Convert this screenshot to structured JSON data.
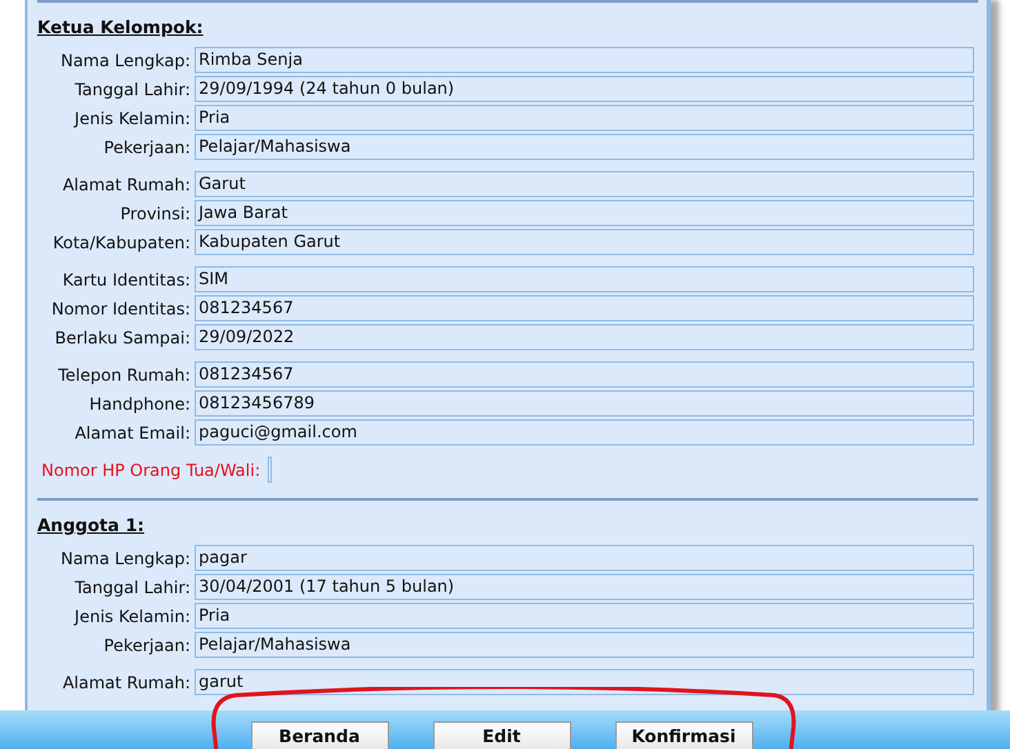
{
  "sections": [
    {
      "title": "Ketua Kelompok:",
      "groups": [
        [
          {
            "label": "Nama Lengkap:",
            "value": "Rimba Senja",
            "missing": false
          },
          {
            "label": "Tanggal Lahir:",
            "value": "29/09/1994 (24 tahun 0 bulan)",
            "missing": false
          },
          {
            "label": "Jenis Kelamin:",
            "value": "Pria",
            "missing": false
          },
          {
            "label": "Pekerjaan:",
            "value": "Pelajar/Mahasiswa",
            "missing": false
          }
        ],
        [
          {
            "label": "Alamat Rumah:",
            "value": "Garut",
            "missing": false
          },
          {
            "label": "Provinsi:",
            "value": "Jawa Barat",
            "missing": false
          },
          {
            "label": "Kota/Kabupaten:",
            "value": "Kabupaten Garut",
            "missing": false
          }
        ],
        [
          {
            "label": "Kartu Identitas:",
            "value": "SIM",
            "missing": false
          },
          {
            "label": "Nomor Identitas:",
            "value": "081234567",
            "missing": false
          },
          {
            "label": "Berlaku Sampai:",
            "value": "29/09/2022",
            "missing": false
          }
        ],
        [
          {
            "label": "Telepon Rumah:",
            "value": "081234567",
            "missing": false
          },
          {
            "label": "Handphone:",
            "value": "08123456789",
            "missing": false
          },
          {
            "label": "Alamat Email:",
            "value": "paguci@gmail.com",
            "missing": false
          }
        ],
        [
          {
            "label": "Nomor HP Orang Tua/Wali:",
            "missing": true
          }
        ]
      ]
    },
    {
      "title": "Anggota 1:",
      "groups": [
        [
          {
            "label": "Nama Lengkap:",
            "value": "pagar",
            "missing": false
          },
          {
            "label": "Tanggal Lahir:",
            "value": "30/04/2001 (17 tahun 5 bulan)",
            "missing": false
          },
          {
            "label": "Jenis Kelamin:",
            "value": "Pria",
            "missing": false
          },
          {
            "label": "Pekerjaan:",
            "value": "Pelajar/Mahasiswa",
            "missing": false
          }
        ],
        [
          {
            "label": "Alamat Rumah:",
            "value": "garut",
            "missing": false
          }
        ]
      ]
    }
  ],
  "buttons": [
    "Beranda",
    "Edit",
    "Konfirmasi"
  ]
}
